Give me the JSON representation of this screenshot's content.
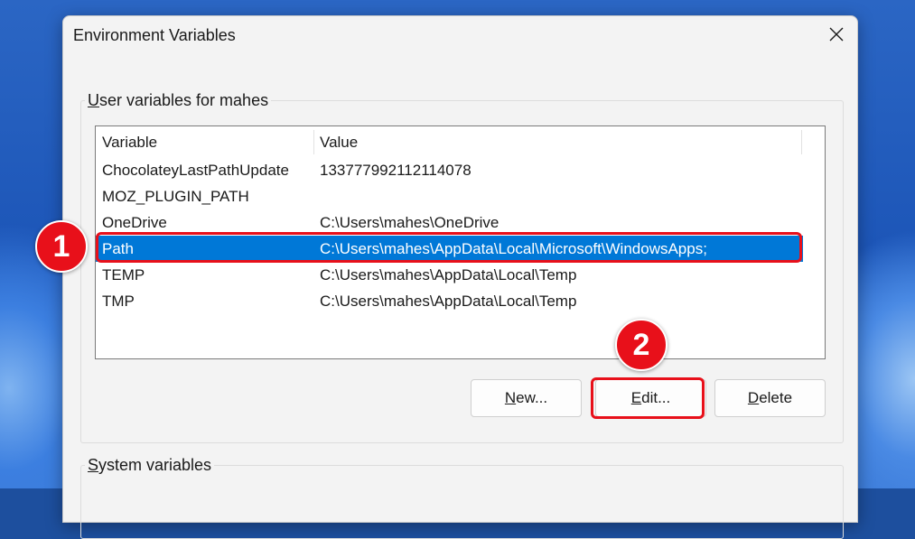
{
  "dialog": {
    "title": "Environment Variables",
    "user_group_label_mnemonic": "U",
    "user_group_label_rest": "ser variables for mahes",
    "system_group_label_mnemonic": "S",
    "system_group_label_rest": "ystem variables"
  },
  "list": {
    "columns": [
      "Variable",
      "Value"
    ],
    "rows": [
      {
        "variable": "ChocolateyLastPathUpdate",
        "value": "133777992112114078"
      },
      {
        "variable": "MOZ_PLUGIN_PATH",
        "value": ""
      },
      {
        "variable": "OneDrive",
        "value": "C:\\Users\\mahes\\OneDrive"
      },
      {
        "variable": "Path",
        "value": "C:\\Users\\mahes\\AppData\\Local\\Microsoft\\WindowsApps;"
      },
      {
        "variable": "TEMP",
        "value": "C:\\Users\\mahes\\AppData\\Local\\Temp"
      },
      {
        "variable": "TMP",
        "value": "C:\\Users\\mahes\\AppData\\Local\\Temp"
      }
    ],
    "selected_index": 3
  },
  "buttons": {
    "new_mnemonic": "N",
    "new_rest": "ew...",
    "edit_mnemonic": "E",
    "edit_rest": "dit...",
    "delete_mnemonic": "D",
    "delete_rest": "elete"
  },
  "annotations": {
    "step1": "1",
    "step2": "2",
    "color": "#e8101a"
  },
  "icons": {
    "close": "close-icon"
  }
}
